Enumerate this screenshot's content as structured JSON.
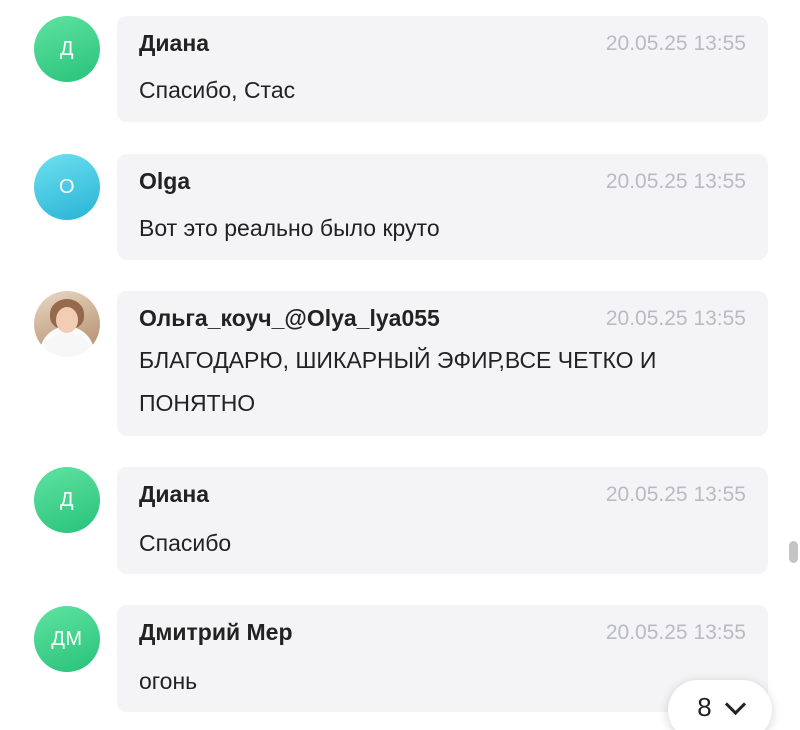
{
  "messages": [
    {
      "avatar_initials": "Д",
      "avatar_color": "#2fcf86",
      "name": "Диана",
      "time": "20.05.25 13:55",
      "text": "Спасибо, Стас"
    },
    {
      "avatar_initials": "O",
      "avatar_color": "#33bde0",
      "name": "Olga",
      "time": "20.05.25 13:55",
      "text": "Вот это реально было круто"
    },
    {
      "avatar_initials": "",
      "avatar_color": "photo",
      "name": "Ольга_коуч_@Olya_lya055",
      "time": "20.05.25 13:55",
      "text": "БЛАГОДАРЮ, ШИКАРНЫЙ ЭФИР,ВСЕ ЧЕТКО И ПОНЯТНО"
    },
    {
      "avatar_initials": "Д",
      "avatar_color": "#2fcf86",
      "name": "Диана",
      "time": "20.05.25 13:55",
      "text": "Спасибо"
    },
    {
      "avatar_initials": "ДМ",
      "avatar_color": "#2fcf86",
      "name": "Дмитрий Мер",
      "time": "20.05.25 13:55",
      "text": "огонь"
    }
  ],
  "jump_button": {
    "count": "8",
    "icon": "chevron-down-icon"
  },
  "colors": {
    "bubble_bg": "#f4f4f6",
    "time_text": "#b9bbc0",
    "name_text": "#222222"
  }
}
